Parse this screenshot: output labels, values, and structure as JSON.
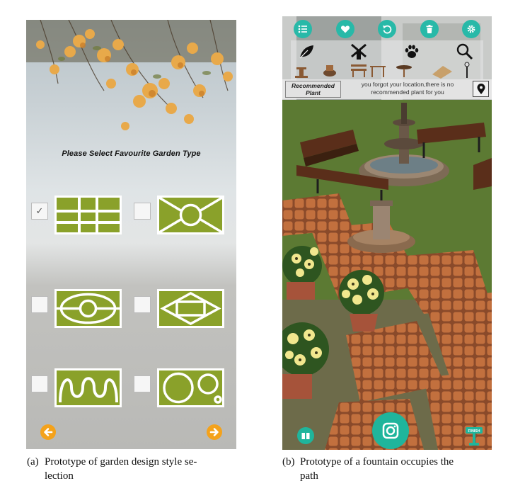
{
  "panel_a": {
    "prompt": "Please Select Favourite Garden Type",
    "options": [
      {
        "pattern": "grid",
        "checked": true
      },
      {
        "pattern": "circle-x",
        "checked": false
      },
      {
        "pattern": "ellipse-rings",
        "checked": false
      },
      {
        "pattern": "diamond",
        "checked": false
      },
      {
        "pattern": "wave",
        "checked": false
      },
      {
        "pattern": "circles",
        "checked": false
      }
    ],
    "check_mark": "✓",
    "prev_icon": "arrow-left-icon",
    "next_icon": "arrow-right-icon",
    "colors": {
      "lawn": "#8aa12a",
      "path": "#ffffff",
      "arrow": "#f4a21b"
    }
  },
  "panel_b": {
    "top_buttons": [
      "list-icon",
      "heart-icon",
      "undo-icon",
      "trash-icon",
      "settings-icon"
    ],
    "categories": [
      "leaf-icon",
      "windmill-icon",
      "paw-icon",
      "magnifier-icon"
    ],
    "recommended_label": "Recommended Plant",
    "recommendation_text": "you forgot your location,there is no recommended plant for you",
    "finish_label": "FINISH",
    "colors": {
      "accent": "#1fb59c"
    }
  },
  "captions": [
    {
      "tag": "(a)",
      "line1": "Prototype of garden design style se-",
      "line2": "lection"
    },
    {
      "tag": "(b)",
      "line1": "Prototype of a fountain occupies the",
      "line2": "path"
    }
  ]
}
